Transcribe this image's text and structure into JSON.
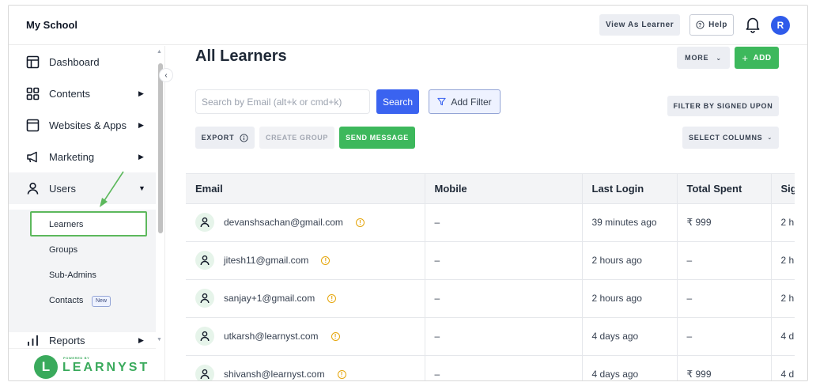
{
  "header": {
    "brand": "My School",
    "view_as_learner": "View As Learner",
    "help": "Help",
    "avatar_initial": "R"
  },
  "sidebar": {
    "items": [
      {
        "label": "Dashboard",
        "icon": "dashboard-icon"
      },
      {
        "label": "Contents",
        "icon": "grid-icon"
      },
      {
        "label": "Websites & Apps",
        "icon": "browser-icon"
      },
      {
        "label": "Marketing",
        "icon": "megaphone-icon"
      },
      {
        "label": "Users",
        "icon": "user-icon"
      },
      {
        "label": "Reports",
        "icon": "bar-chart-icon"
      }
    ],
    "sub_items": [
      {
        "label": "Learners"
      },
      {
        "label": "Groups"
      },
      {
        "label": "Sub-Admins"
      },
      {
        "label": "Contacts"
      }
    ],
    "new_badge": "New",
    "powered_by": "POWERED BY",
    "brand_word": "LEARNYST",
    "brand_letter": "L"
  },
  "main": {
    "title": "All Learners",
    "more": "MORE",
    "add": "ADD",
    "search_placeholder": "Search by Email (alt+k or cmd+k)",
    "search_button": "Search",
    "add_filter": "Add Filter",
    "filter_signed": "FILTER BY SIGNED UPON",
    "export": "EXPORT",
    "create_group": "CREATE GROUP",
    "send_message": "SEND MESSAGE",
    "select_columns": "SELECT COLUMNS"
  },
  "table": {
    "columns": [
      "Email",
      "Mobile",
      "Last Login",
      "Total Spent",
      "Sig"
    ],
    "rows": [
      {
        "email": "devanshsachan@gmail.com",
        "mobile": "–",
        "last_login": "39 minutes ago",
        "total_spent": "₹ 999",
        "signed": "2 h"
      },
      {
        "email": "jitesh11@gmail.com",
        "mobile": "–",
        "last_login": "2 hours ago",
        "total_spent": "–",
        "signed": "2 h"
      },
      {
        "email": "sanjay+1@gmail.com",
        "mobile": "–",
        "last_login": "2 hours ago",
        "total_spent": "–",
        "signed": "2 h"
      },
      {
        "email": "utkarsh@learnyst.com",
        "mobile": "–",
        "last_login": "4 days ago",
        "total_spent": "–",
        "signed": "4 d"
      },
      {
        "email": "shivansh@learnyst.com",
        "mobile": "–",
        "last_login": "4 days ago",
        "total_spent": "₹ 999",
        "signed": "4 d"
      }
    ]
  },
  "colors": {
    "primary_blue": "#3a63f0",
    "green": "#3db85c",
    "highlight_box": "#5cb85c",
    "warning": "#e5a50a"
  }
}
